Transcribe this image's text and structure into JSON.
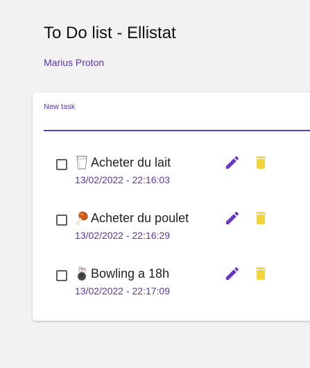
{
  "app": {
    "title": "To Do list - Ellistat",
    "author": "Marius Proton"
  },
  "new_task": {
    "label": "New task",
    "value": "",
    "placeholder": ""
  },
  "colors": {
    "accent": "#6236c4",
    "edit_icon": "#6a38c2",
    "delete_icon": "#f5d33f"
  },
  "tasks": [
    {
      "icon": "milk-glass-icon",
      "text": "Acheter du lait",
      "date": "13/02/2022 - 22:16:03",
      "checked": false
    },
    {
      "icon": "poultry-leg-icon",
      "text": "Acheter du poulet",
      "date": "13/02/2022 - 22:16:29",
      "checked": false
    },
    {
      "icon": "bowling-icon",
      "text": "Bowling a 18h",
      "date": "13/02/2022 - 22:17:09",
      "checked": false
    }
  ]
}
